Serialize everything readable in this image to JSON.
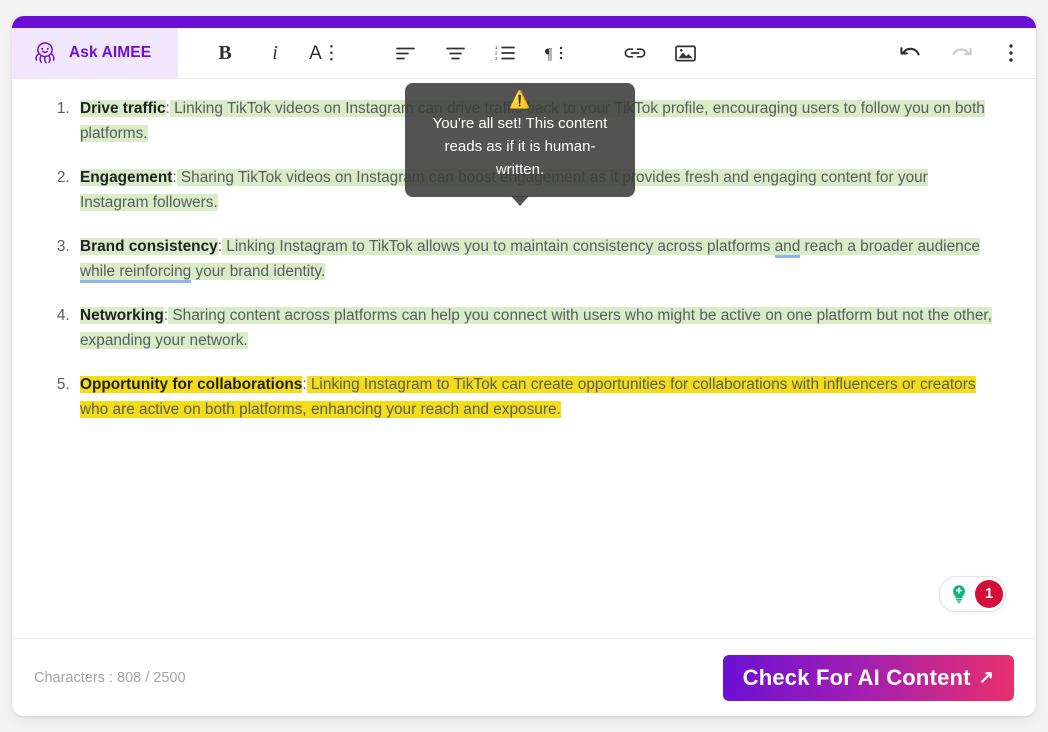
{
  "theme": {
    "accent_purple": "#6b10d4",
    "highlight_green": "#d8ecc8",
    "highlight_yellow": "#f3dc18",
    "grammar_underline": "#8fb2f5",
    "badge_red": "#d4103a",
    "bulb_green": "#0ab87f"
  },
  "toolbar": {
    "assistant_label": "Ask AIMEE",
    "assistant_icon": "octopus-icon",
    "bold_label": "B",
    "italic_label": "i",
    "text_style_label": "A⋮",
    "align_left_icon": "align-left-icon",
    "align_center_icon": "align-center-icon",
    "numbered_list_icon": "numbered-list-icon",
    "paragraph_icon": "paragraph-format-icon",
    "link_icon": "link-icon",
    "image_icon": "image-icon",
    "undo_icon": "undo-icon",
    "redo_icon": "redo-icon",
    "more_icon": "more-vertical-icon"
  },
  "tooltip": {
    "warning_icon": "warning-triangle-icon",
    "text": "You're all set! This content reads as if it is human-written."
  },
  "document": {
    "items": [
      {
        "number": "1.",
        "term": "Drive traffic",
        "separator": ":",
        "body": " Linking TikTok videos on Instagram can drive traffic back to your TikTok profile, encouraging users to follow you on both platforms.",
        "highlight": "green"
      },
      {
        "number": "2.",
        "term": "Engagement",
        "separator": ":",
        "body": " Sharing TikTok videos on Instagram can boost engagement as it provides fresh and engaging content for your Instagram followers.",
        "highlight": "green"
      },
      {
        "number": "3.",
        "term": "Brand consistency",
        "separator": ":",
        "body_part_1": " Linking Instagram to TikTok allows you to maintain consistency across platforms ",
        "grammar_word_1": "and",
        "body_part_2": " reach a broader audience ",
        "grammar_word_2": "while reinforcing",
        "body_part_3": " your brand identity.",
        "highlight": "green"
      },
      {
        "number": "4.",
        "term": "Networking",
        "separator": ":",
        "body": " Sharing content across platforms can help you connect with users who might be active on one platform but not the other, expanding your network.",
        "highlight": "green"
      },
      {
        "number": "5.",
        "term": "Opportunity for collaborations",
        "separator": ":",
        "body": " Linking Instagram to TikTok can create opportunities for collaborations with influencers or creators who are active on both platforms, enhancing your reach and exposure.",
        "highlight": "yellow"
      }
    ]
  },
  "suggestions": {
    "bulb_icon": "lightbulb-icon",
    "count": "1"
  },
  "footer": {
    "character_label": "Characters :",
    "character_count": "808",
    "character_limit": "/ 2500",
    "cta_label": "Check For AI Content",
    "cta_arrow": "↗"
  }
}
